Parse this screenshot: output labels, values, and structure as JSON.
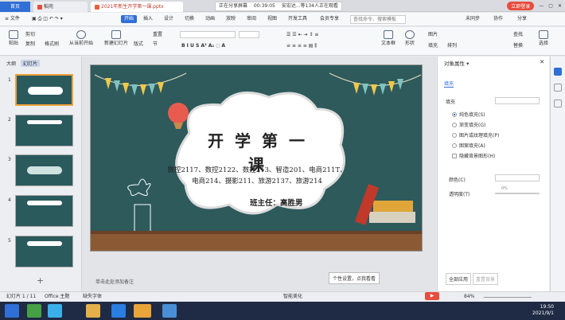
{
  "tabs": {
    "home": "首页",
    "file_tab": "稻壳",
    "doc_tab": "2021年新生开学第一课.pptx"
  },
  "sharebar": {
    "label": "正在分享屏幕",
    "time": "00:39:05",
    "viewers": "安宏达...等134人正在观看"
  },
  "topright": {
    "login": "立即登录"
  },
  "menu": {
    "file": "≡ 文件",
    "items": [
      "开始",
      "插入",
      "设计",
      "切换",
      "动画",
      "放映",
      "审阅",
      "视图",
      "开发工具",
      "会员专享"
    ],
    "search": "查找命令、搜索模板",
    "right": [
      "未同步",
      "协作",
      "分享"
    ]
  },
  "ribbon": {
    "paste": "粘贴",
    "cut": "剪切",
    "copy": "复制",
    "format_painter": "格式刷",
    "from_start": "从当前开始",
    "new_slide": "新建幻灯片",
    "layout": "版式",
    "section": "节",
    "reset": "重置",
    "textbox": "文本框",
    "shape": "形状",
    "arrange": "排列",
    "picture": "图片",
    "fill": "填充",
    "find": "查找",
    "replace": "替换",
    "select": "选择"
  },
  "leftpane": {
    "tab_outline": "大纲",
    "tab_slides": "幻灯片",
    "slide_numbers": [
      "1",
      "2",
      "3",
      "4",
      "5"
    ]
  },
  "slide": {
    "title_chars": [
      "开",
      "学",
      "第",
      "一",
      "课"
    ],
    "classes_line1": "数控2117、数控2122、数控213、智造201、电商211T、",
    "classes_line2": "电商214、摄影211、旅游2137、旅游214",
    "teacher": "班主任：高胜男"
  },
  "notes": {
    "placeholder": "单击此处添加备注"
  },
  "rightpane": {
    "title": "对象属性 ▾",
    "tab": "填充",
    "section": "填充",
    "options": [
      "纯色填充(S)",
      "渐变填充(G)",
      "图片或纹理填充(P)",
      "图案填充(A)",
      "隐藏背景图形(H)"
    ],
    "color_label": "颜色(C)",
    "transparency_label": "透明度(T)",
    "transparency_value": "0%",
    "apply_all": "全部应用",
    "reset_bg": "重置背景"
  },
  "tooltip": "个性设置，点我看看",
  "statusbar": {
    "slide_info": "幻灯片 1 / 11",
    "theme": "Office 主题",
    "font_missing": "缺失字体",
    "smart_beautify": "智能美化",
    "zoom": "84%"
  },
  "taskbar": {
    "time": "19:50",
    "date": "2021/9/1"
  }
}
